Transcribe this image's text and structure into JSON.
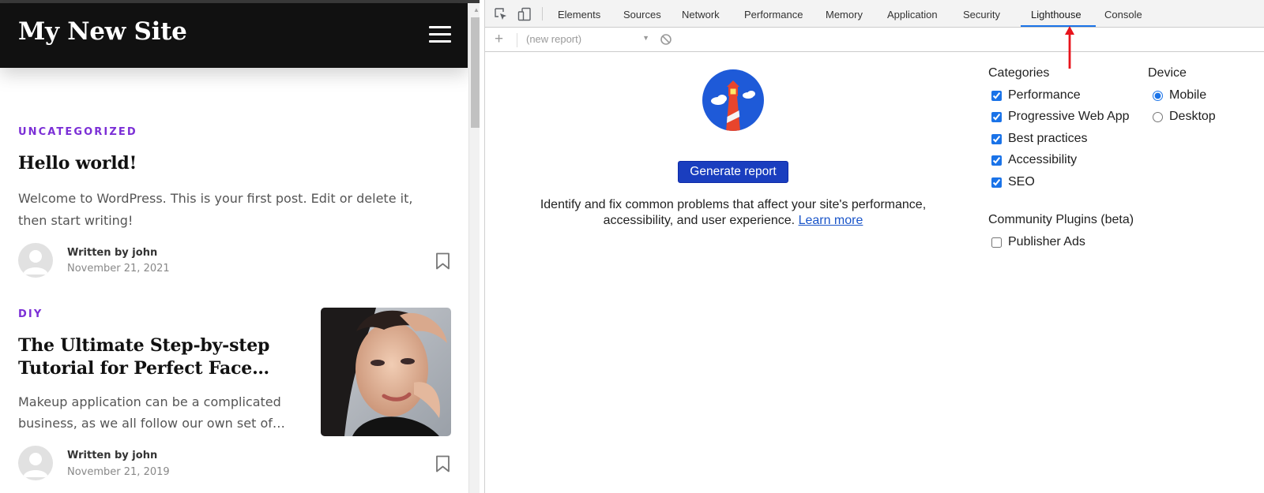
{
  "site": {
    "title": "My New Site",
    "posts": [
      {
        "category": "UNCATEGORIZED",
        "title": "Hello world!",
        "excerpt_lines": [
          "Welcome to WordPress. This is your first post. Edit or delete it,",
          "then start writing!"
        ],
        "author": "Written by john",
        "date": "November 21, 2021"
      },
      {
        "category": "DIY",
        "title_lines": [
          "The Ultimate Step-by-step",
          "Tutorial for Perfect Face…"
        ],
        "excerpt_lines": [
          "Makeup application can be a complicated",
          "business, as we all follow our own set of…"
        ],
        "author": "Written by john",
        "date": "November 21, 2019"
      }
    ]
  },
  "devtools": {
    "tabs": [
      "Elements",
      "Sources",
      "Network",
      "Performance",
      "Memory",
      "Application",
      "Security",
      "Lighthouse",
      "Console"
    ],
    "active_tab": "Lighthouse",
    "toolbar": {
      "add_label": "+",
      "report_select": "(new report)"
    },
    "lighthouse": {
      "generate_button": "Generate report",
      "description_line1": "Identify and fix common problems that affect your site's performance,",
      "description_line2": "accessibility, and user experience.",
      "learn_more": "Learn more",
      "categories_heading": "Categories",
      "categories": [
        {
          "label": "Performance",
          "checked": true
        },
        {
          "label": "Progressive Web App",
          "checked": true
        },
        {
          "label": "Best practices",
          "checked": true
        },
        {
          "label": "Accessibility",
          "checked": true
        },
        {
          "label": "SEO",
          "checked": true
        }
      ],
      "device_heading": "Device",
      "devices": [
        {
          "label": "Mobile",
          "selected": true
        },
        {
          "label": "Desktop",
          "selected": false
        }
      ],
      "plugins_heading": "Community Plugins (beta)",
      "plugins": [
        {
          "label": "Publisher Ads",
          "checked": false
        }
      ]
    }
  },
  "colors": {
    "site_header_bg": "#111111",
    "category_accent": "#7b2fd6",
    "active_tab_underline": "#1a73e8",
    "generate_button_bg": "#1a3ebf",
    "link": "#1a55c9",
    "annotation_arrow": "#e8141c"
  },
  "icons": {
    "hamburger": "hamburger-menu-icon",
    "bookmark": "bookmark-icon",
    "inspect": "inspect-element-icon",
    "device_toggle": "device-toggle-icon",
    "clear": "clear-block-icon",
    "lighthouse_logo": "lighthouse-logo-icon",
    "annotation": "red-arrow-up-icon"
  }
}
